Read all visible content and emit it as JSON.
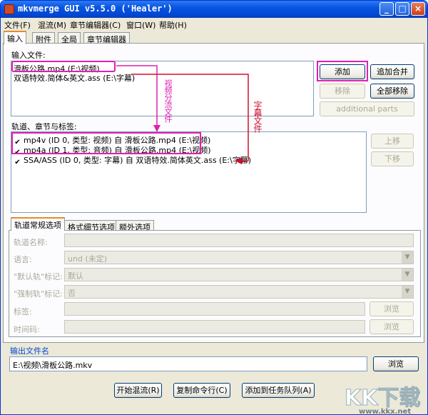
{
  "window": {
    "title": "mkvmerge GUI v5.5.0 ('Healer')"
  },
  "menu": [
    "文件(F)",
    "混流(M)",
    "章节编辑器(C)",
    "窗口(W)",
    "帮助(H)"
  ],
  "tabs": [
    "输入",
    "附件",
    "全局",
    "章节编辑器"
  ],
  "input_files": {
    "label": "输入文件:",
    "items": [
      "滑板公路.mp4 (E:\\视频)",
      "双语特效.简体&英文.ass (E:\\字幕)"
    ]
  },
  "buttons": {
    "add": "添加",
    "append": "追加合并",
    "remove": "移除",
    "remove_all": "全部移除",
    "additional_parts": "additional parts",
    "up": "上移",
    "down": "下移",
    "browse1": "浏览",
    "browse2": "浏览",
    "browse_out": "浏览",
    "start": "开始混流(R)",
    "copy_cmd": "复制命令行(C)",
    "add_job": "添加到任务队列(A)"
  },
  "tracks": {
    "label": "轨道、章节与标签:",
    "items": [
      {
        "checked": true,
        "text": "mp4v (ID 0, 类型: 视频) 自 滑板公路.mp4 (E:\\视频)"
      },
      {
        "checked": true,
        "text": "mp4a (ID 1, 类型: 音频) 自 滑板公路.mp4 (E:\\视频)"
      },
      {
        "checked": true,
        "text": "SSA/ASS (ID 0, 类型: 字幕) 自 双语特效.简体英文.ass (E:\\字幕)"
      }
    ]
  },
  "subtabs": [
    "轨道常规选项",
    "格式细节选项",
    "额外选项"
  ],
  "fields": {
    "track_name": {
      "label": "轨道名称:",
      "value": ""
    },
    "language": {
      "label": "语言:",
      "value": "und (未定)"
    },
    "default_flag": {
      "label": "\"默认轨\"标记:",
      "value": "默认"
    },
    "forced_flag": {
      "label": "\"强制轨\"标记:",
      "value": "否"
    },
    "tags": {
      "label": "标签:",
      "value": ""
    },
    "timecodes": {
      "label": "时间码:",
      "value": ""
    }
  },
  "output": {
    "label": "输出文件名",
    "value": "E:\\视频\\滑板公路.mkv"
  },
  "annotations": {
    "video_split": "视频分流文件",
    "subtitle_file": "字幕文件"
  },
  "colors": {
    "annotation_magenta": "#e020b0",
    "annotation_red": "#d0102a",
    "titlebar": "#0a54e0"
  },
  "watermark": {
    "logo": "KK下载",
    "url": "www.kkx.net"
  }
}
